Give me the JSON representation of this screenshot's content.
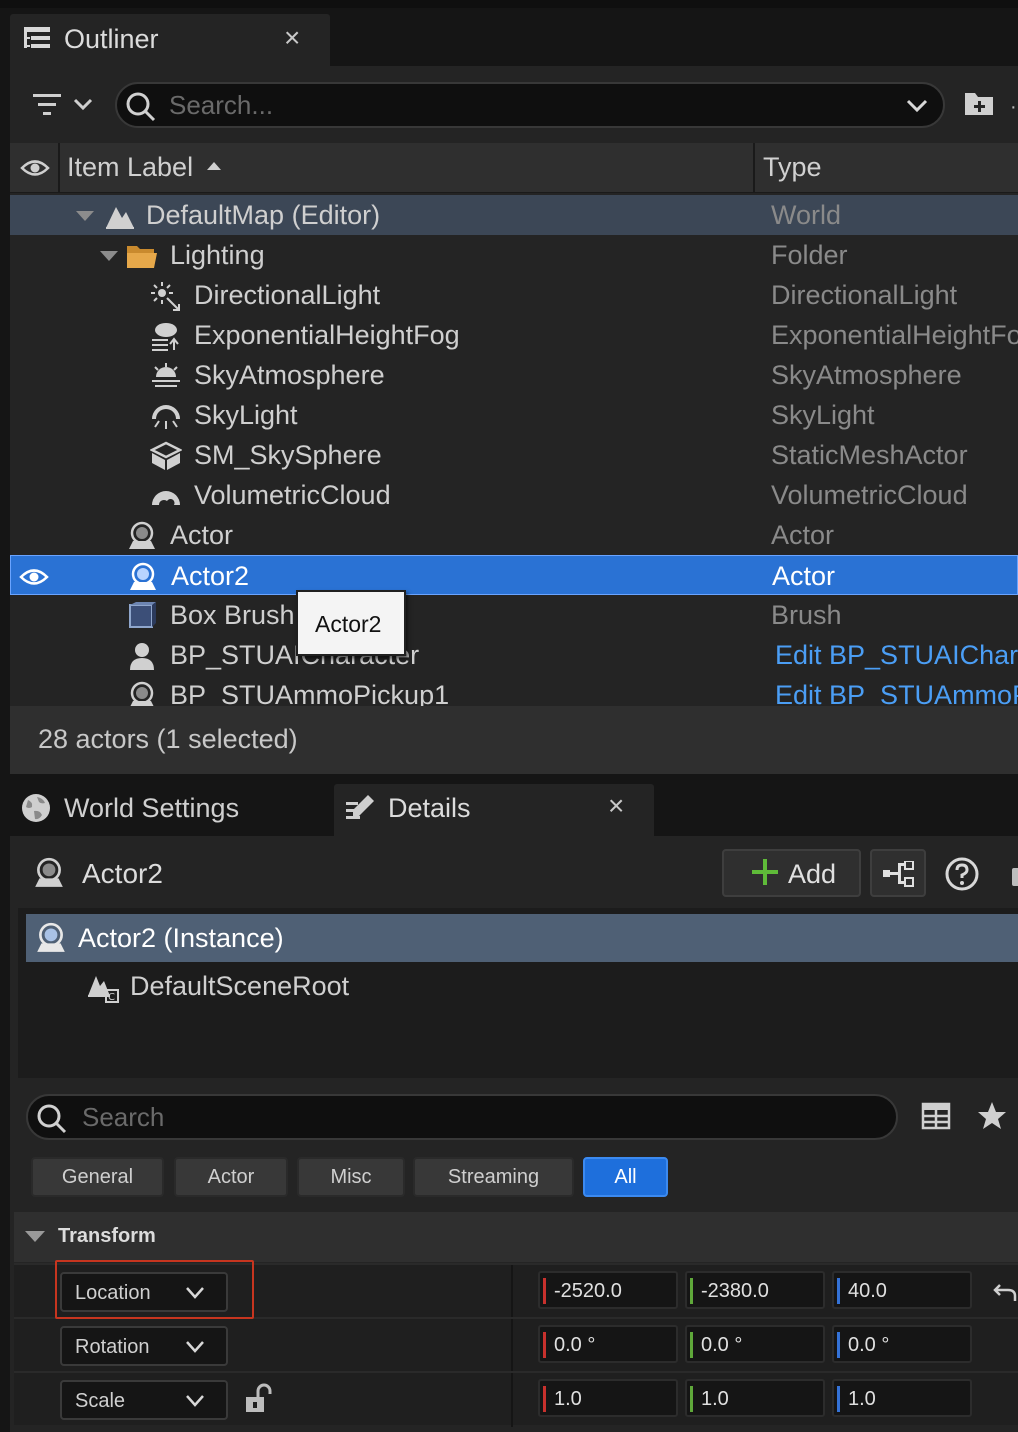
{
  "outliner": {
    "tab_title": "Outliner",
    "tab_close": "×",
    "search_placeholder": "Search...",
    "columns": {
      "label": "Item Label",
      "type": "Type"
    },
    "rows": [
      {
        "label": "DefaultMap (Editor)",
        "type": "World",
        "icon": "world-icon"
      },
      {
        "label": "Lighting",
        "type": "Folder",
        "icon": "folder-icon"
      },
      {
        "label": "DirectionalLight",
        "type": "DirectionalLight",
        "icon": "directional-light-icon"
      },
      {
        "label": "ExponentialHeightFog",
        "type": "ExponentialHeightFo",
        "icon": "fog-icon"
      },
      {
        "label": "SkyAtmosphere",
        "type": "SkyAtmosphere",
        "icon": "sky-atmosphere-icon"
      },
      {
        "label": "SkyLight",
        "type": "SkyLight",
        "icon": "sky-light-icon"
      },
      {
        "label": "SM_SkySphere",
        "type": "StaticMeshActor",
        "icon": "static-mesh-icon"
      },
      {
        "label": "VolumetricCloud",
        "type": "VolumetricCloud",
        "icon": "cloud-icon"
      },
      {
        "label": "Actor",
        "type": "Actor",
        "icon": "actor-icon"
      },
      {
        "label": "Actor2",
        "type": "Actor",
        "icon": "actor-icon"
      },
      {
        "label": "Box Brush",
        "type": "Brush",
        "icon": "brush-icon"
      },
      {
        "label": "BP_STUAICharacter",
        "type": "Edit BP_STUAIChara",
        "icon": "character-icon"
      },
      {
        "label": "BP_STUAmmoPickup1",
        "type": "Edit BP_STUAmmoP",
        "icon": "actor-icon"
      }
    ],
    "tooltip": "Actor2",
    "status": "28 actors (1 selected)"
  },
  "details": {
    "world_settings_tab": "World Settings",
    "details_tab": "Details",
    "details_close": "×",
    "actor_name": "Actor2",
    "add_label": "Add",
    "components": [
      {
        "label": "Actor2 (Instance)"
      },
      {
        "label": "DefaultSceneRoot"
      }
    ],
    "search_placeholder": "Search",
    "categories": [
      "General",
      "Actor",
      "Misc",
      "Streaming",
      "All"
    ],
    "active_category": "All",
    "transform": {
      "header": "Transform",
      "location": {
        "label": "Location",
        "x": "-2520.0",
        "y": "-2380.0",
        "z": "40.0"
      },
      "rotation": {
        "label": "Rotation",
        "x": "0.0 °",
        "y": "0.0 °",
        "z": "0.0 °"
      },
      "scale": {
        "label": "Scale",
        "x": "1.0",
        "y": "1.0",
        "z": "1.0"
      }
    }
  },
  "colors": {
    "selection": "#2a72d4",
    "world_row": "#3c4756",
    "link": "#4b9ef5",
    "x_axis": "#c8312d",
    "y_axis": "#5fa83a",
    "z_axis": "#3472d6",
    "highlight_box": "#c7351f"
  }
}
